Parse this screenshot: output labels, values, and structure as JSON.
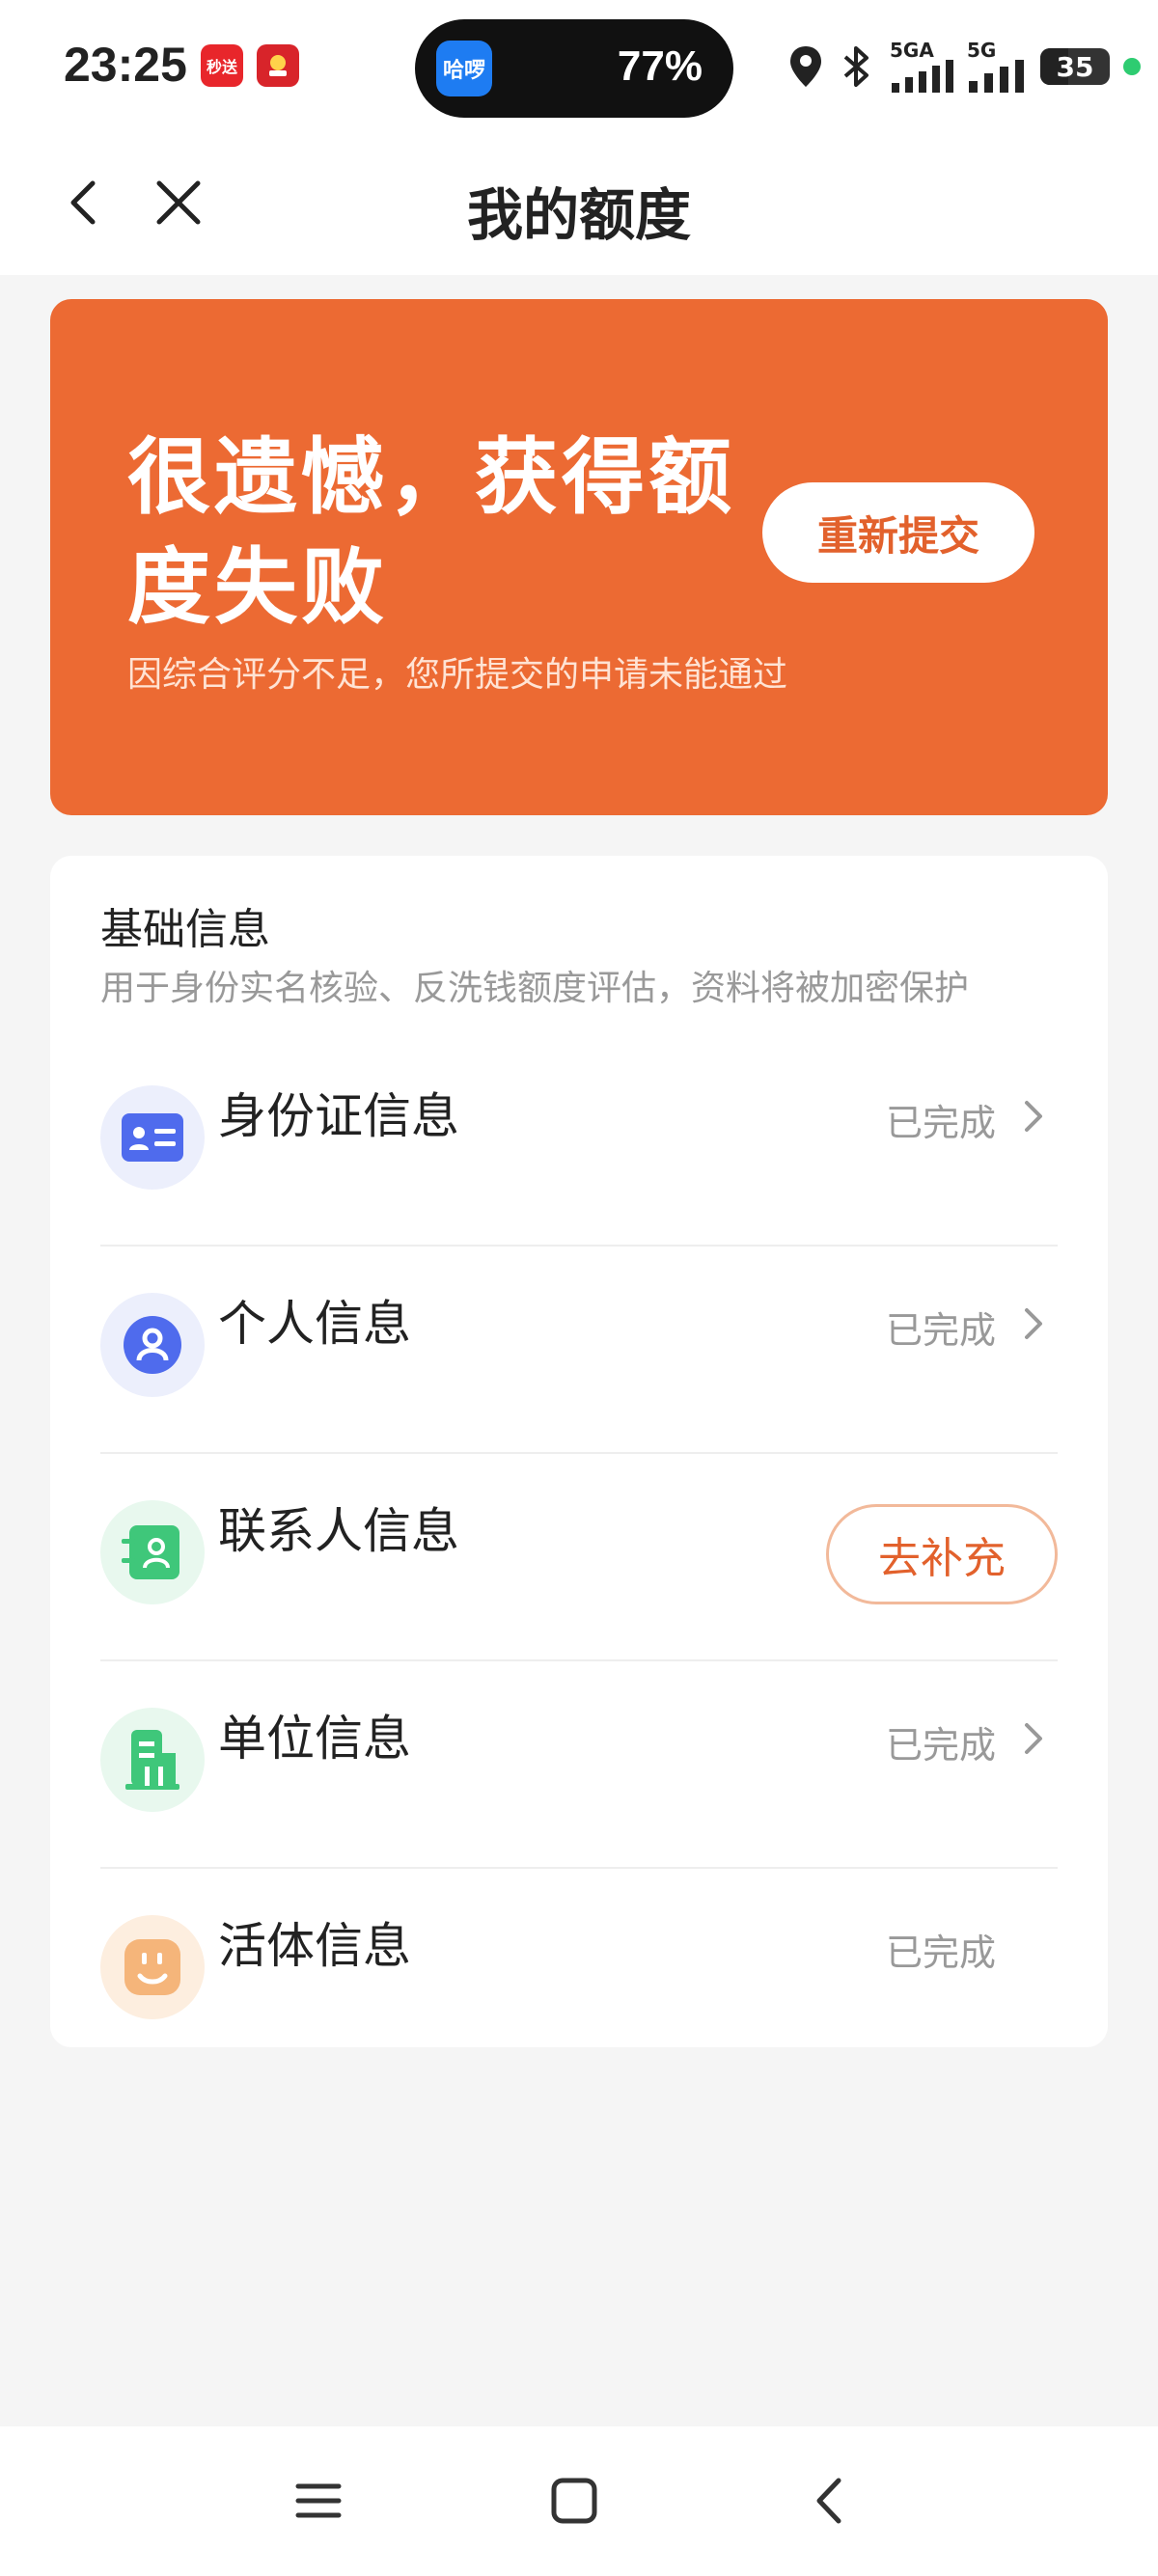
{
  "status_bar": {
    "time": "23:25",
    "app_icon_1": "秒送",
    "island_app": "哈啰",
    "island_value": "77%",
    "network_1": "5GA",
    "network_2": "5G",
    "battery": "35",
    "icons": [
      "location-icon",
      "bluetooth-icon",
      "signal-icon",
      "battery-icon"
    ]
  },
  "nav": {
    "title": "我的额度",
    "back_icon": "chevron-left-icon",
    "close_icon": "close-icon"
  },
  "banner": {
    "title": "很遗憾，获得额度失败",
    "subtitle": "因综合评分不足，您所提交的申请未能通过",
    "button_label": "重新提交",
    "color": "#ec6a33"
  },
  "info_card": {
    "title": "基础信息",
    "description": "用于身份实名核验、反洗钱额度评估，资料将被加密保护",
    "items": [
      {
        "label": "身份证信息",
        "status": "已完成",
        "icon": "id-card-icon"
      },
      {
        "label": "个人信息",
        "status": "已完成",
        "icon": "person-icon"
      },
      {
        "label": "联系人信息",
        "action": "去补充",
        "icon": "contacts-icon"
      },
      {
        "label": "单位信息",
        "status": "已完成",
        "icon": "building-icon"
      },
      {
        "label": "活体信息",
        "status": "已完成",
        "icon": "face-icon"
      }
    ]
  },
  "system_nav": {
    "icons": [
      "menu-icon",
      "home-icon",
      "back-icon"
    ]
  }
}
